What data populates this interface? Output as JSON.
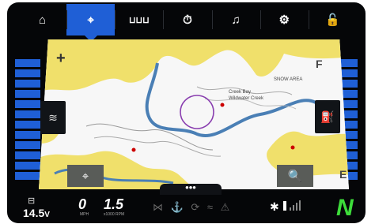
{
  "nav": {
    "tabs": [
      {
        "id": "home",
        "icon": "home-icon",
        "glyph": "⌂",
        "active": false
      },
      {
        "id": "navigation",
        "icon": "location-pin-icon",
        "glyph": "⌖",
        "active": true
      },
      {
        "id": "depth",
        "icon": "depth-ruler-icon",
        "glyph": "⊔⊔⊔",
        "active": false
      },
      {
        "id": "gauges",
        "icon": "speedometer-icon",
        "glyph": "⏱",
        "active": false
      },
      {
        "id": "audio",
        "icon": "music-note-icon",
        "glyph": "♫",
        "active": false
      },
      {
        "id": "settings",
        "icon": "gear-icon",
        "glyph": "⚙",
        "active": false
      },
      {
        "id": "lock",
        "icon": "unlock-icon",
        "glyph": "🔓",
        "active": false
      }
    ]
  },
  "map": {
    "compass_left": "F",
    "compass_right": "F",
    "compass_bottom_right": "E",
    "zoom_in": "+",
    "labels": [
      "Creek Bay",
      "Wildwater Creek",
      "SNOW AREA"
    ],
    "locate_glyph": "⌖",
    "search_glyph": "🔍",
    "more_glyph": "•••",
    "colors": {
      "land": "#f0e06b",
      "water": "#f7f7f7",
      "deep": "#4a7fb5"
    }
  },
  "status": {
    "battery_voltage": "14.5",
    "battery_unit": "V",
    "speed_value": "0",
    "speed_unit": "MPH",
    "rpm_value": "1.5",
    "rpm_unit": "x1000 RPM",
    "gear": "N"
  }
}
